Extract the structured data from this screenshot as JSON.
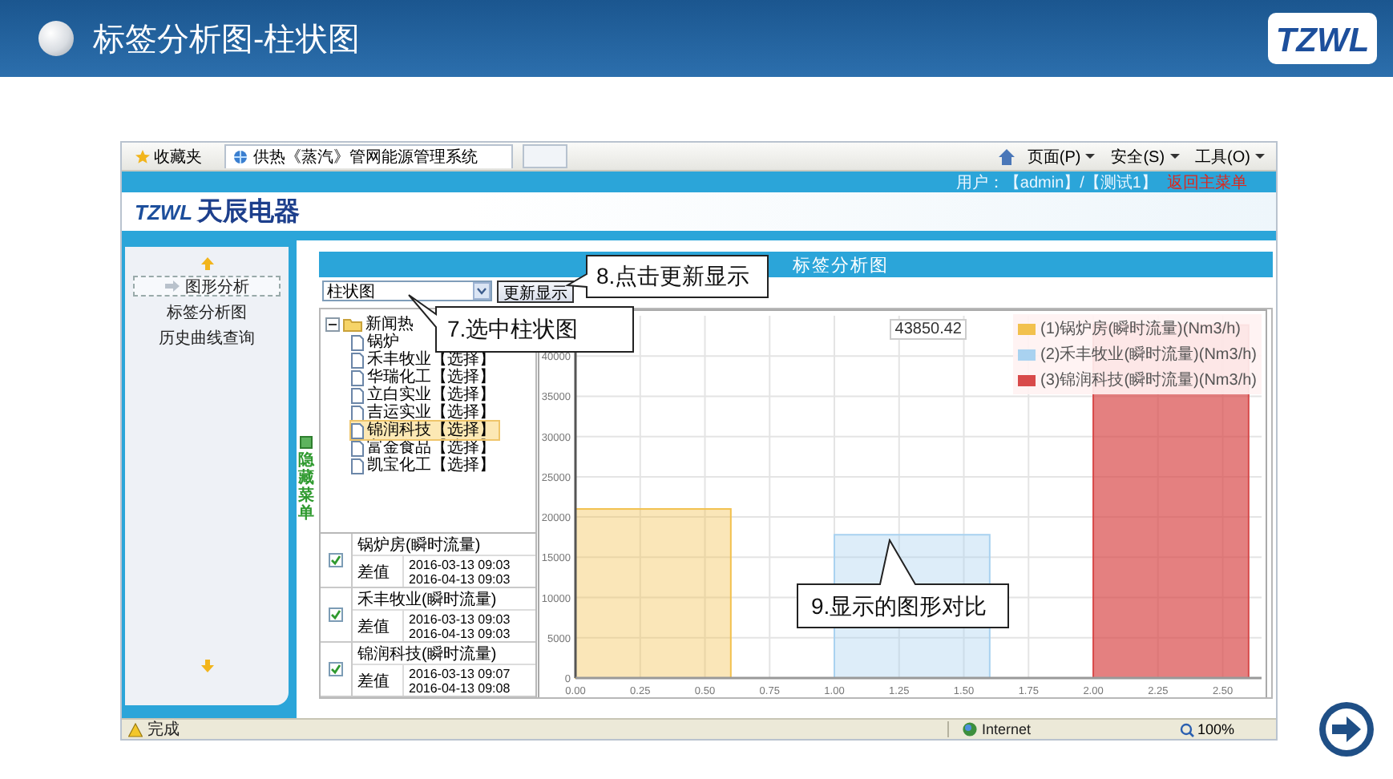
{
  "slide": {
    "title": "标签分析图-柱状图",
    "logo": "TZWL"
  },
  "browser": {
    "favorites": "收藏夹",
    "tab_title": "供热《蒸汽》管网能源管理系统",
    "menus": [
      "页面(P)",
      "安全(S)",
      "工具(O)"
    ]
  },
  "app": {
    "user": "用户：【admin】/【测试1】",
    "back_link": "返回主菜单",
    "logo": "TZWL",
    "brand": "天辰电器"
  },
  "sidebar": {
    "items": [
      {
        "label": "图形分析",
        "selected": true
      },
      {
        "label": "标签分析图",
        "selected": false
      },
      {
        "label": "历史曲线查询",
        "selected": false
      }
    ],
    "hide_menu": "隐藏菜单"
  },
  "panel": {
    "title": "标签分析图",
    "chart_type": "柱状图",
    "update_button": "更新显示",
    "tree": {
      "label": "新闻热",
      "expanded": true,
      "children": [
        {
          "label": "锅炉",
          "selected": false
        },
        {
          "label": "禾丰牧业【选择】",
          "selected": false
        },
        {
          "label": "华瑞化工【选择】",
          "selected": false
        },
        {
          "label": "立白实业【选择】",
          "selected": false
        },
        {
          "label": "吉运实业【选择】",
          "selected": false
        },
        {
          "label": "锦润科技【选择】",
          "selected": true
        },
        {
          "label": "富金食品【选择】",
          "selected": false
        },
        {
          "label": "凯宝化工【选择】",
          "selected": false
        }
      ]
    },
    "selected_tags": [
      {
        "name": "锅炉房(瞬时流量)",
        "checked": true,
        "mode": "差值",
        "start": "2016-03-13 09:03",
        "end": "2016-04-13 09:03"
      },
      {
        "name": "禾丰牧业(瞬时流量)",
        "checked": true,
        "mode": "差值",
        "start": "2016-03-13 09:03",
        "end": "2016-04-13 09:03"
      },
      {
        "name": "锦润科技(瞬时流量)",
        "checked": true,
        "mode": "差值",
        "start": "2016-03-13 09:07",
        "end": "2016-04-13 09:08"
      }
    ],
    "chart": {
      "tooltip": "43850.42",
      "chart_data": {
        "type": "bar",
        "x": [
          0,
          1,
          2
        ],
        "series": [
          {
            "name": "(1)锅炉房(瞬时流量)(Nm3/h)",
            "color": "#f2c14e",
            "values": [
              21000,
              null,
              null
            ]
          },
          {
            "name": "(2)禾丰牧业(瞬时流量)(Nm3/h)",
            "color": "#a9d2f0",
            "values": [
              null,
              17800,
              null
            ]
          },
          {
            "name": "(3)锦润科技(瞬时流量)(Nm3/h)",
            "color": "#d84a4a",
            "values": [
              null,
              null,
              43850.42
            ]
          }
        ],
        "grid": true,
        "legend": true,
        "xlim": [
          0,
          2.65
        ],
        "ylim": [
          0,
          45000
        ],
        "xticks": [
          {
            "value": 0,
            "label": "0.00"
          },
          {
            "value": 0.25,
            "label": "0.25"
          },
          {
            "value": 0.5,
            "label": "0.50"
          },
          {
            "value": 0.75,
            "label": "0.75"
          },
          {
            "value": 1,
            "label": "1.00"
          },
          {
            "value": 1.25,
            "label": "1.25"
          },
          {
            "value": 1.5,
            "label": "1.50"
          },
          {
            "value": 1.75,
            "label": "1.75"
          },
          {
            "value": 2,
            "label": "2.00"
          },
          {
            "value": 2.25,
            "label": "2.25"
          },
          {
            "value": 2.5,
            "label": "2.50"
          }
        ],
        "yticks": [
          0,
          5000,
          10000,
          15000,
          20000,
          25000,
          30000,
          35000,
          40000
        ]
      }
    }
  },
  "callouts": [
    "8.点击更新显示",
    "7.选中柱状图",
    "9.显示的图形对比"
  ],
  "status_bar": {
    "text": "完成",
    "zone": "Internet",
    "zoom": "100%"
  }
}
